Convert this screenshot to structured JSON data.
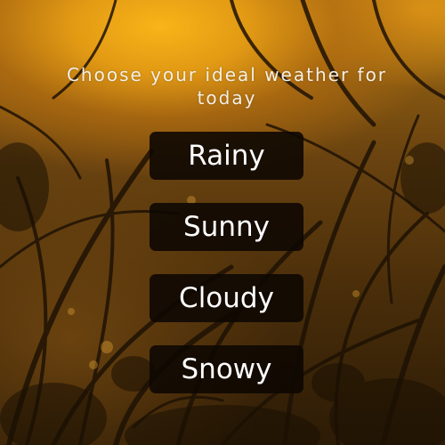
{
  "prompt": {
    "text": "Choose your ideal weather for today"
  },
  "options": [
    {
      "label": "Rainy"
    },
    {
      "label": "Sunny"
    },
    {
      "label": "Cloudy"
    },
    {
      "label": "Snowy"
    }
  ],
  "colors": {
    "button_background": "#0e0802",
    "button_text": "#ffffff",
    "prompt_text": "#f4efe6",
    "sunset_glow": "#f8b418"
  }
}
